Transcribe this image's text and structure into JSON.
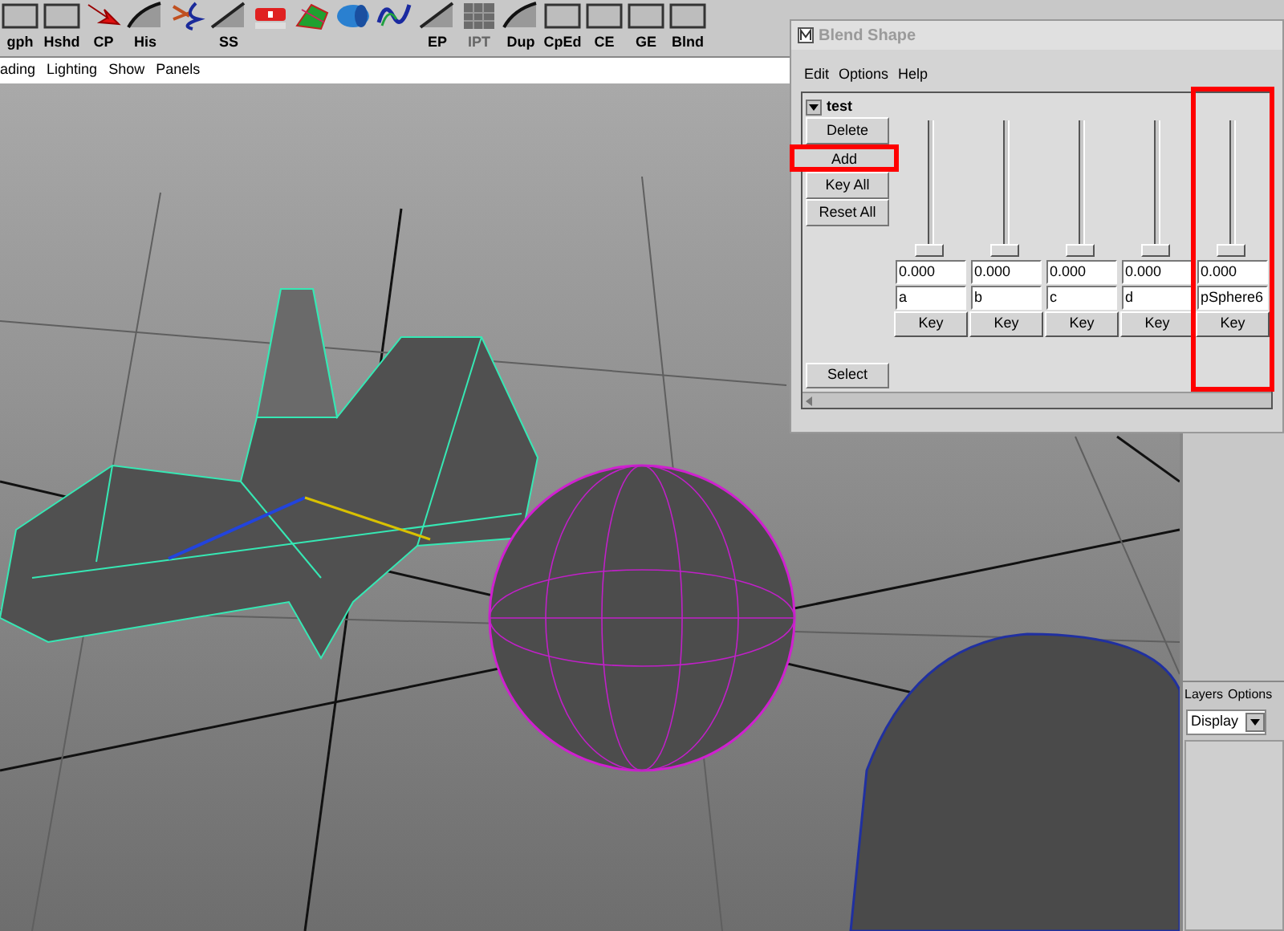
{
  "shelf": [
    {
      "label": "gph",
      "kind": "blank"
    },
    {
      "label": "Hshd",
      "kind": "blank"
    },
    {
      "label": "CP",
      "kind": "arrow"
    },
    {
      "label": "His",
      "kind": "curve"
    },
    {
      "kind": "scissors"
    },
    {
      "label": "SS",
      "kind": "slash"
    },
    {
      "kind": "tool"
    },
    {
      "kind": "mesh"
    },
    {
      "kind": "cylinder"
    },
    {
      "kind": "wave"
    },
    {
      "label": "EP",
      "kind": "slash"
    },
    {
      "label": "IPT",
      "kind": "cube"
    },
    {
      "label": "Dup",
      "kind": "curve"
    },
    {
      "label": "CpEd",
      "kind": "blank"
    },
    {
      "label": "CE",
      "kind": "blank"
    },
    {
      "label": "GE",
      "kind": "blank"
    },
    {
      "label": "Blnd",
      "kind": "blank"
    }
  ],
  "viewport_menu": [
    "ading",
    "Lighting",
    "Show",
    "Panels"
  ],
  "blend_window": {
    "title": "Blend Shape",
    "menu": [
      "Edit",
      "Options",
      "Help"
    ],
    "node": "test",
    "buttons": [
      {
        "label": "Delete",
        "highlighted": false
      },
      {
        "label": "Add",
        "highlighted": true
      },
      {
        "label": "Key All",
        "highlighted": false
      },
      {
        "label": "Reset All",
        "highlighted": false
      }
    ],
    "select_button": "Select",
    "targets": [
      {
        "value": "0.000",
        "name": "a",
        "key": "Key",
        "level": 0,
        "highlighted": false
      },
      {
        "value": "0.000",
        "name": "b",
        "key": "Key",
        "level": 0,
        "highlighted": false
      },
      {
        "value": "0.000",
        "name": "c",
        "key": "Key",
        "level": 0,
        "highlighted": false
      },
      {
        "value": "0.000",
        "name": "d",
        "key": "Key",
        "level": 0,
        "highlighted": false
      },
      {
        "value": "0.000",
        "name": "pSphere6",
        "key": "Key",
        "level": 0,
        "highlighted": true
      }
    ]
  },
  "layers_panel": {
    "menu": [
      "Layers",
      "Options"
    ],
    "dropdown": "Display"
  }
}
